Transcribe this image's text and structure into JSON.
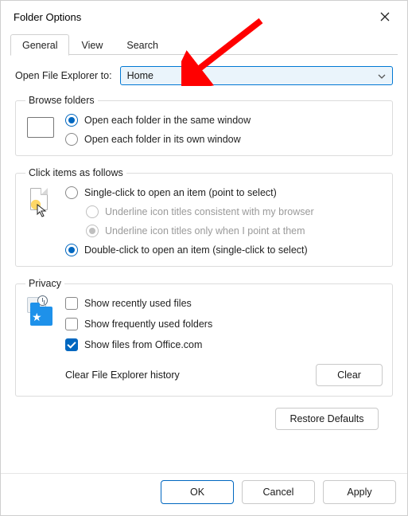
{
  "title": "Folder Options",
  "tabs": {
    "general": "General",
    "view": "View",
    "search": "Search"
  },
  "open_to": {
    "label": "Open File Explorer to:",
    "value": "Home"
  },
  "browse": {
    "legend": "Browse folders",
    "same": "Open each folder in the same window",
    "own": "Open each folder in its own window"
  },
  "click": {
    "legend": "Click items as follows",
    "single": "Single-click to open an item (point to select)",
    "underline_browser": "Underline icon titles consistent with my browser",
    "underline_point": "Underline icon titles only when I point at them",
    "double": "Double-click to open an item (single-click to select)"
  },
  "privacy": {
    "legend": "Privacy",
    "recent": "Show recently used files",
    "frequent": "Show frequently used folders",
    "office": "Show files from Office.com",
    "clear_label": "Clear File Explorer history",
    "clear_btn": "Clear"
  },
  "restore": "Restore Defaults",
  "buttons": {
    "ok": "OK",
    "cancel": "Cancel",
    "apply": "Apply"
  }
}
